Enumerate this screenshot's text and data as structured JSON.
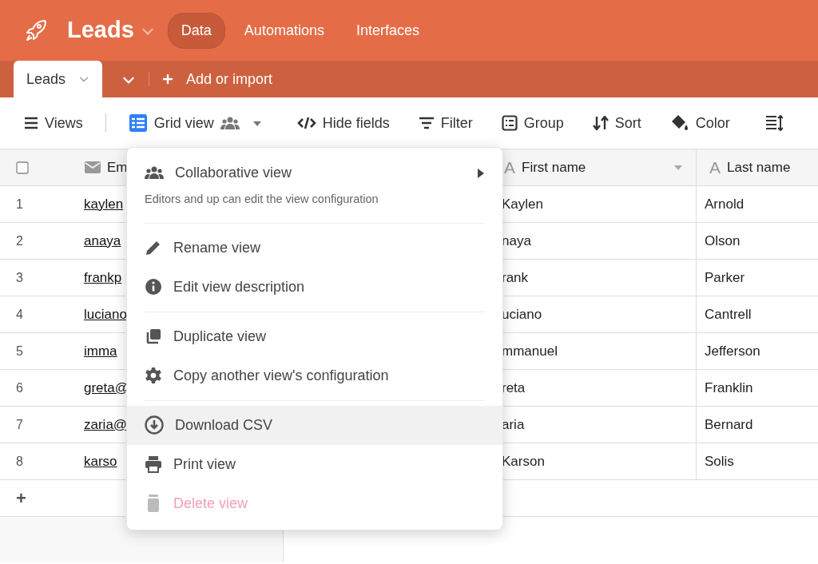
{
  "app": {
    "title": "Leads",
    "nav": [
      {
        "label": "Data",
        "selected": true
      },
      {
        "label": "Automations",
        "selected": false
      },
      {
        "label": "Interfaces",
        "selected": false
      }
    ]
  },
  "table_tabs": {
    "tabs": [
      {
        "label": "Leads",
        "selected": true
      }
    ],
    "add_label": "Add or import"
  },
  "toolbar": [
    {
      "kind": "views",
      "label": "Views"
    },
    {
      "kind": "view",
      "label": "Grid view"
    },
    {
      "kind": "hide",
      "label": "Hide fields"
    },
    {
      "kind": "filter",
      "label": "Filter"
    },
    {
      "kind": "group",
      "label": "Group"
    },
    {
      "kind": "sort",
      "label": "Sort"
    },
    {
      "kind": "color",
      "label": "Color"
    },
    {
      "kind": "height"
    }
  ],
  "grid": {
    "columns": [
      {
        "kind": "email",
        "label": "Em"
      },
      {
        "kind": "hidden"
      },
      {
        "kind": "text",
        "glyph": "A",
        "label": "First name",
        "menu": true
      },
      {
        "kind": "text",
        "glyph": "A",
        "label": "Last name"
      }
    ],
    "rows": [
      {
        "number": "1",
        "email": "kaylen",
        "first_name": "Kaylen",
        "last_name": "Arnold"
      },
      {
        "number": "2",
        "email": "anaya",
        "first_name": "naya",
        "last_name": "Olson"
      },
      {
        "number": "3",
        "email": "frankp",
        "first_name": "rank",
        "last_name": "Parker"
      },
      {
        "number": "4",
        "email": "luciano",
        "first_name": "uciano",
        "last_name": "Cantrell"
      },
      {
        "number": "5",
        "email": "imma",
        "first_name": "mmanuel",
        "last_name": "Jefferson"
      },
      {
        "number": "6",
        "email": "greta@",
        "first_name": "reta",
        "last_name": "Franklin"
      },
      {
        "number": "7",
        "email": "zaria@",
        "first_name": "aria",
        "last_name": "Bernard"
      },
      {
        "number": "8",
        "email": "karso",
        "first_name": "Karson",
        "last_name": "Solis"
      }
    ],
    "add_row": "+"
  },
  "menu": [
    {
      "kind": "collaborative",
      "label": "Collaborative view",
      "description": "Editors and up can edit the view configuration"
    },
    {
      "kind": "divider"
    },
    {
      "kind": "rename",
      "label": "Rename view",
      "selected": false,
      "disabled": false
    },
    {
      "kind": "describe",
      "label": "Edit view description",
      "selected": false,
      "disabled": false
    },
    {
      "kind": "divider"
    },
    {
      "kind": "duplicate",
      "label": "Duplicate view",
      "selected": false,
      "disabled": false
    },
    {
      "kind": "copy",
      "label": "Copy another view's configuration",
      "selected": false,
      "disabled": false
    },
    {
      "kind": "divider"
    },
    {
      "kind": "download",
      "label": "Download CSV",
      "selected": true,
      "disabled": false
    },
    {
      "kind": "print",
      "label": "Print view",
      "selected": false,
      "disabled": false
    },
    {
      "kind": "delete",
      "label": "Delete view",
      "selected": false,
      "disabled": true
    }
  ]
}
